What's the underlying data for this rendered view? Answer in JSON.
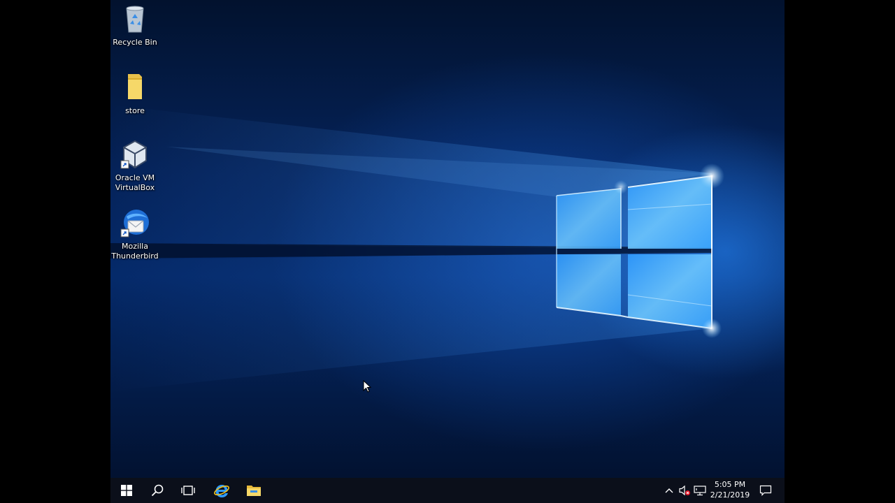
{
  "desktop": {
    "icons": [
      {
        "label": "Recycle Bin",
        "icon": "recycle-bin-icon"
      },
      {
        "label": "store",
        "icon": "folder-icon"
      },
      {
        "label": "Oracle VM\nVirtualBox",
        "icon": "virtualbox-icon"
      },
      {
        "label": "Mozilla\nThunderbird",
        "icon": "thunderbird-icon"
      }
    ]
  },
  "taskbar": {
    "pinned": [
      {
        "icon": "windows-start-icon"
      },
      {
        "icon": "search-icon"
      },
      {
        "icon": "task-view-icon"
      },
      {
        "icon": "internet-explorer-icon"
      },
      {
        "icon": "file-explorer-icon"
      }
    ],
    "tray": {
      "icons": [
        "chevron-up-icon",
        "speaker-muted-icon",
        "network-icon",
        "action-center-icon"
      ],
      "time": "5:05 PM",
      "date": "2/21/2019"
    }
  },
  "colors": {
    "taskbar": "#0b0f1a",
    "accent": "#1e90ff"
  }
}
